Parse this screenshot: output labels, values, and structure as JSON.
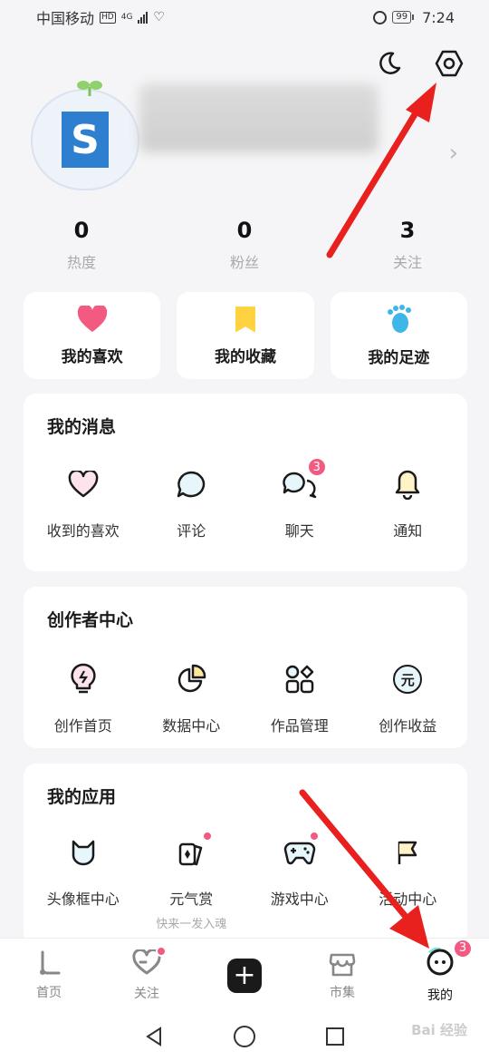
{
  "status_bar": {
    "carrier": "中国移动",
    "network_badge": "HD",
    "network_type": "4G",
    "battery": "99",
    "time": "7:24"
  },
  "top_actions": {
    "night_mode_icon": "moon-icon",
    "settings_icon": "hexagon-gear-icon"
  },
  "profile": {
    "avatar_text": "S"
  },
  "stats": [
    {
      "value": "0",
      "label": "热度"
    },
    {
      "value": "0",
      "label": "粉丝"
    },
    {
      "value": "3",
      "label": "关注"
    }
  ],
  "quick_links": [
    {
      "label": "我的喜欢",
      "icon": "heart-icon",
      "color": "#f25a82"
    },
    {
      "label": "我的收藏",
      "icon": "bookmark-icon",
      "color": "#ffd23f"
    },
    {
      "label": "我的足迹",
      "icon": "footprint-icon",
      "color": "#3fb6e8"
    }
  ],
  "messages": {
    "title": "我的消息",
    "items": [
      {
        "label": "收到的喜欢",
        "icon": "heart-outline-icon"
      },
      {
        "label": "评论",
        "icon": "comment-icon"
      },
      {
        "label": "聊天",
        "icon": "chat-icon",
        "badge": "3"
      },
      {
        "label": "通知",
        "icon": "bell-icon"
      }
    ]
  },
  "creator": {
    "title": "创作者中心",
    "items": [
      {
        "label": "创作首页",
        "icon": "lightbulb-icon"
      },
      {
        "label": "数据中心",
        "icon": "pie-chart-icon"
      },
      {
        "label": "作品管理",
        "icon": "apps-grid-icon"
      },
      {
        "label": "创作收益",
        "icon": "yuan-coin-icon",
        "glyph": "元"
      }
    ]
  },
  "apps": {
    "title": "我的应用",
    "items": [
      {
        "label": "头像框中心",
        "icon": "cat-frame-icon"
      },
      {
        "label": "元气赏",
        "icon": "cards-icon",
        "sub": "快来一发入魂"
      },
      {
        "label": "游戏中心",
        "icon": "gamepad-icon"
      },
      {
        "label": "活动中心",
        "icon": "flag-icon"
      }
    ]
  },
  "tabbar": {
    "tabs": [
      {
        "label": "首页",
        "icon": "home-icon"
      },
      {
        "label": "关注",
        "icon": "follow-heart-icon"
      },
      {
        "label": "",
        "icon": "plus-icon"
      },
      {
        "label": "市集",
        "icon": "shop-icon"
      },
      {
        "label": "我的",
        "icon": "me-face-icon",
        "badge": "3"
      }
    ]
  },
  "watermark": "Bai 经验",
  "colors": {
    "accent_pink": "#f25a82",
    "annotation_red": "#e8201e"
  }
}
